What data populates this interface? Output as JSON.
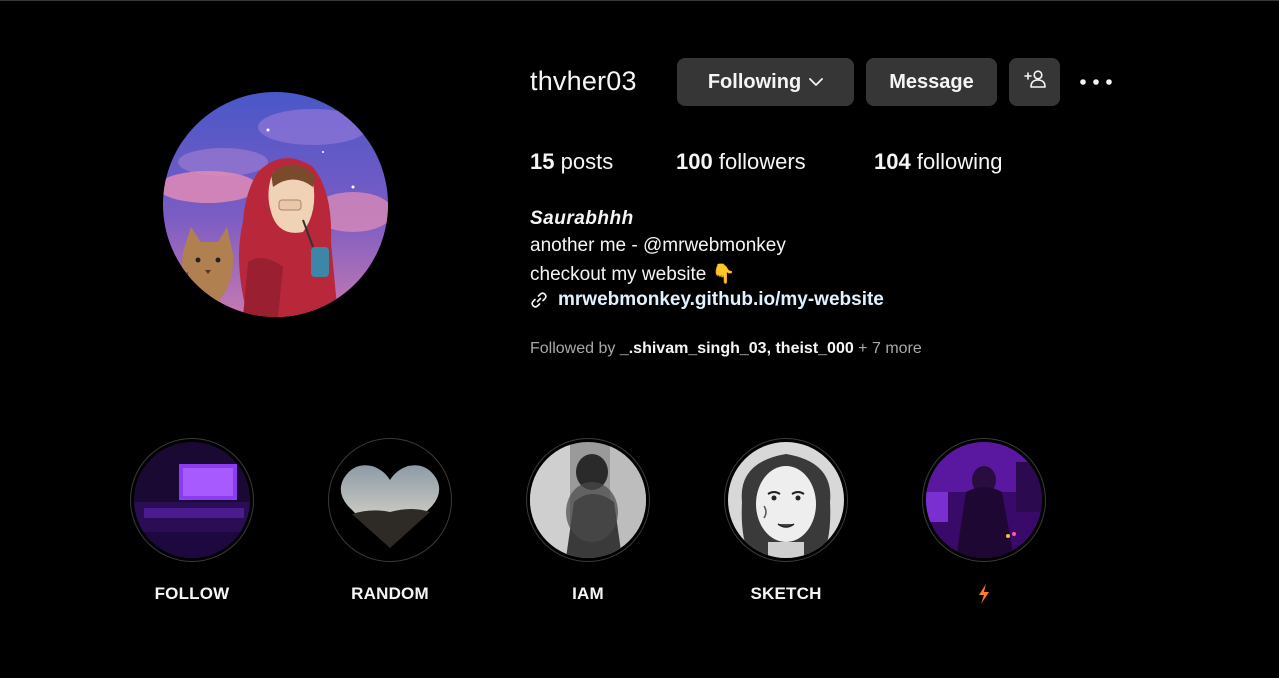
{
  "profile": {
    "username": "thvher03",
    "following_button": "Following",
    "message_button": "Message",
    "stats": {
      "posts_count": "15",
      "posts_label": "posts",
      "followers_count": "100",
      "followers_label": "followers",
      "following_count": "104",
      "following_label": "following"
    },
    "full_name": "Saurabhhh",
    "bio_line1": "another me - @mrwebmonkey",
    "bio_line2": "checkout my website 👇",
    "link": "mrwebmonkey.github.io/my-website",
    "followed_by_prefix": "Followed by",
    "followed_by_accounts": [
      "_.shivam_singh_03",
      "theist_000"
    ],
    "followed_by_separator": ", ",
    "followed_by_more": " + 7 more"
  },
  "highlights": [
    {
      "label": "FOLLOW"
    },
    {
      "label": "RANDOM"
    },
    {
      "label": "IAM"
    },
    {
      "label": "SKETCH"
    },
    {
      "label": "⚡"
    }
  ],
  "colors": {
    "background": "#000000",
    "button": "#363636",
    "text": "#f5f5f5",
    "muted": "#a8a8a8",
    "link": "#e0f1ff"
  },
  "icons": [
    "chevron-down-icon",
    "add-user-icon",
    "more-options-icon",
    "link-icon"
  ]
}
